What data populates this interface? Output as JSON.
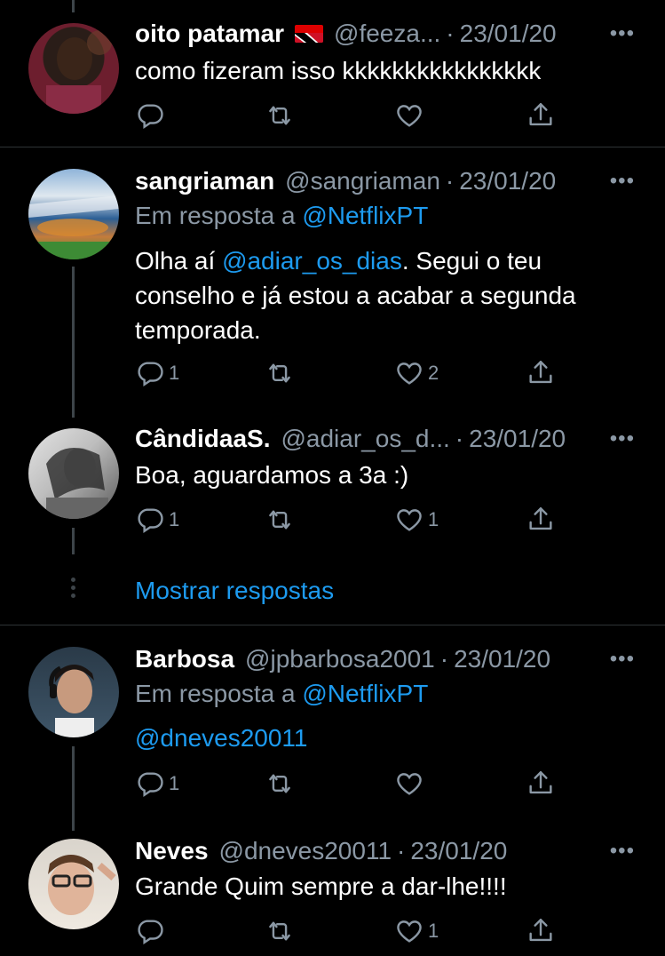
{
  "tweets": [
    {
      "name": "oito patamar",
      "handle": "@feeza...",
      "sep": "·",
      "date": "23/01/20",
      "more": "•••",
      "text": "como fizeram isso kkkkkkkkkkkkkkkk",
      "reply_count": "",
      "like_count": ""
    },
    {
      "name": "sangriaman",
      "handle": "@sangriaman",
      "sep": "·",
      "date": "23/01/20",
      "more": "•••",
      "reply_prefix": "Em resposta a ",
      "reply_to": "@NetflixPT",
      "text_pre": "Olha aí ",
      "text_mention": "@adiar_os_dias",
      "text_post": ". Segui o teu conselho e já estou a acabar a segunda temporada.",
      "reply_count": "1",
      "like_count": "2"
    },
    {
      "name": "CândidaaS.",
      "handle": "@adiar_os_d...",
      "sep": "·",
      "date": "23/01/20",
      "more": "•••",
      "text": "Boa, aguardamos a 3a :)",
      "reply_count": "1",
      "like_count": "1"
    },
    {
      "name": "Barbosa",
      "handle": "@jpbarbosa2001",
      "sep": "·",
      "date": "23/01/20",
      "more": "•••",
      "reply_prefix": "Em resposta a ",
      "reply_to": "@NetflixPT",
      "text_mention": "@dneves20011",
      "reply_count": "1",
      "like_count": ""
    },
    {
      "name": "Neves",
      "handle": "@dneves20011",
      "sep": "·",
      "date": "23/01/20",
      "more": "•••",
      "text": "Grande Quim sempre a dar-lhe!!!!",
      "reply_count": "",
      "like_count": "1"
    }
  ],
  "show_replies": "Mostrar respostas",
  "icons": {
    "reply": "reply-icon",
    "retweet": "retweet-icon",
    "like": "heart-icon",
    "share": "share-icon"
  },
  "colors": {
    "background": "#000000",
    "text": "#ffffff",
    "muted": "#8b98a5",
    "link": "#1d9bf0",
    "divider": "#2f3336"
  }
}
